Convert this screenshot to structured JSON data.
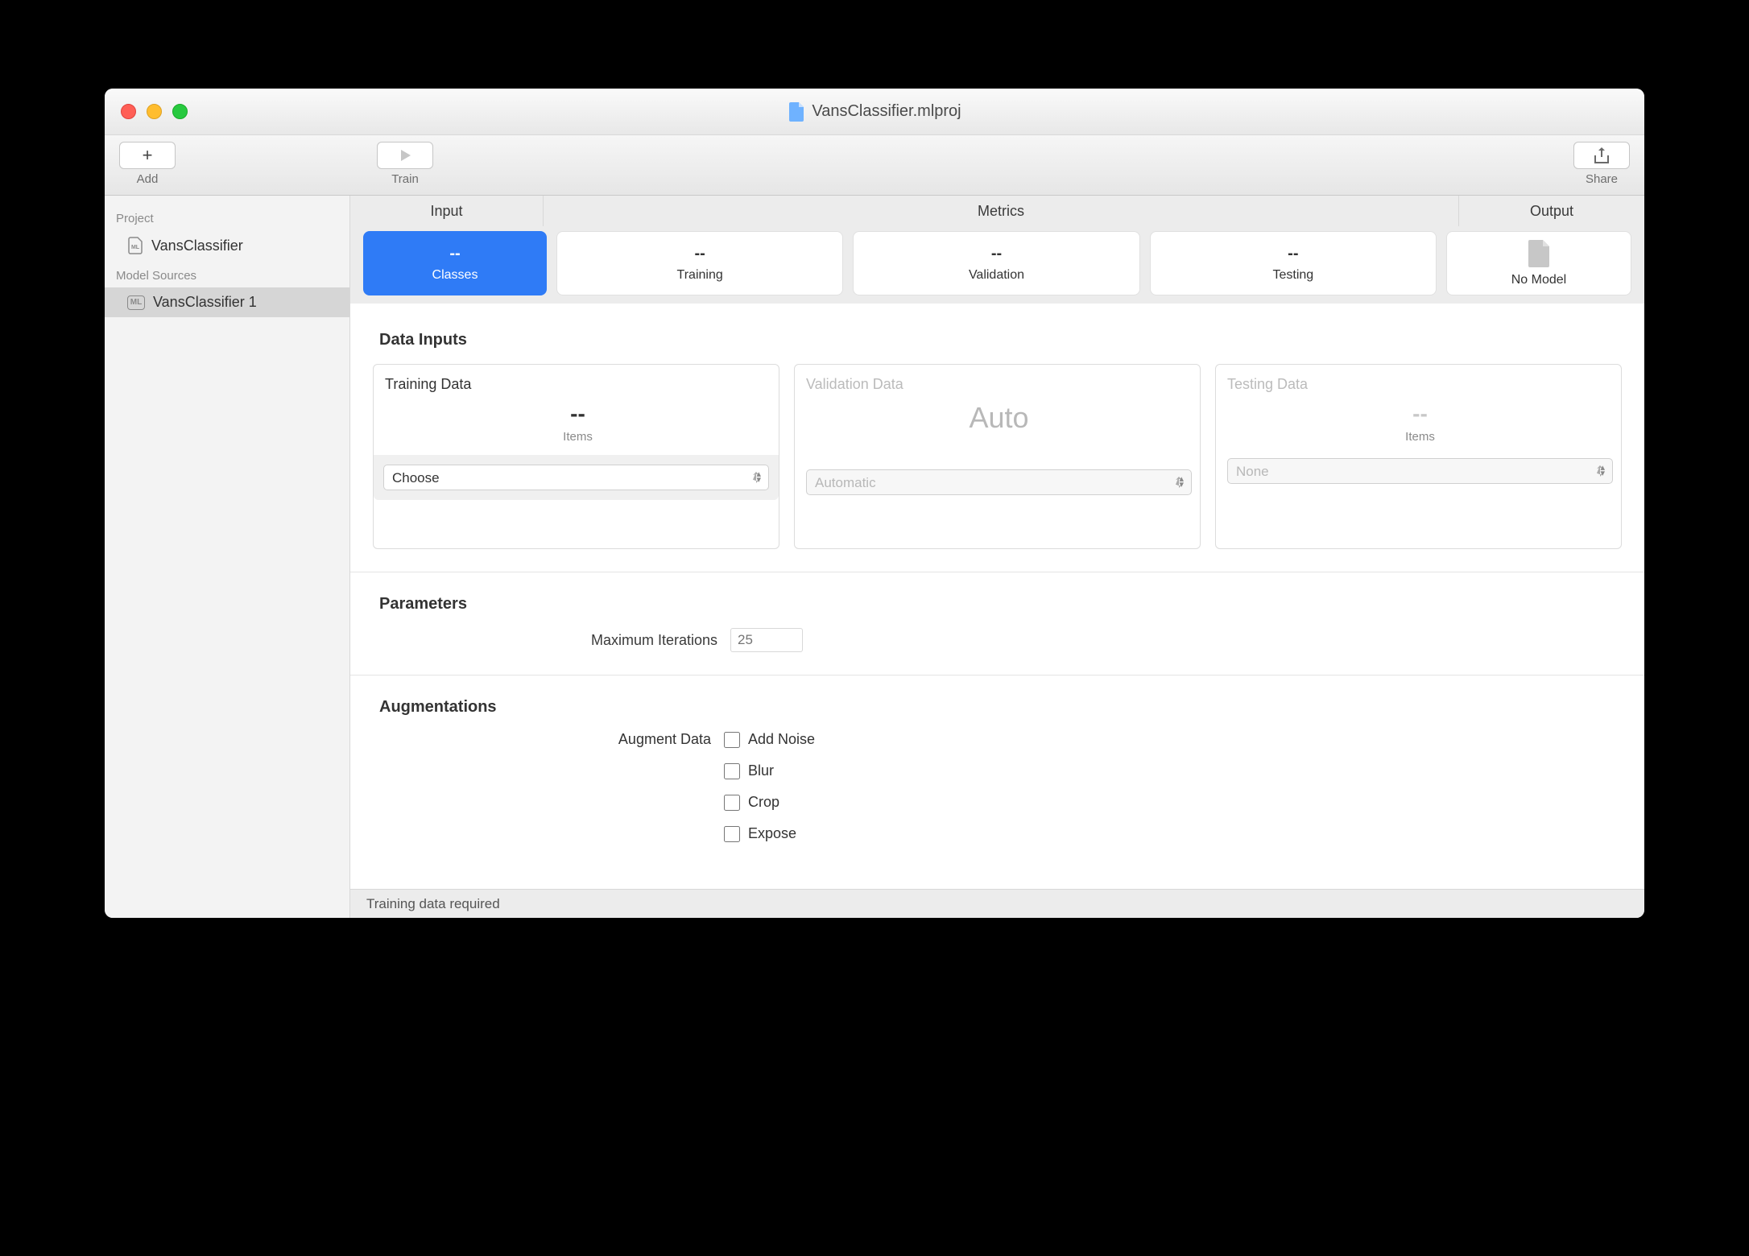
{
  "window": {
    "title": "VansClassifier.mlproj"
  },
  "toolbar": {
    "add_label": "Add",
    "train_label": "Train",
    "share_label": "Share"
  },
  "sidebar": {
    "project_header": "Project",
    "project_item": "VansClassifier",
    "sources_header": "Model Sources",
    "source_item": "VansClassifier 1"
  },
  "tabs": {
    "input": "Input",
    "metrics": "Metrics",
    "output": "Output"
  },
  "cards": {
    "classes": {
      "value": "--",
      "label": "Classes"
    },
    "training": {
      "value": "--",
      "label": "Training"
    },
    "validation": {
      "value": "--",
      "label": "Validation"
    },
    "testing": {
      "value": "--",
      "label": "Testing"
    },
    "output": {
      "label": "No Model"
    }
  },
  "sections": {
    "data_inputs": "Data Inputs",
    "parameters": "Parameters",
    "augmentations": "Augmentations"
  },
  "data_inputs": {
    "training": {
      "title": "Training Data",
      "value": "--",
      "sub": "Items",
      "select": "Choose"
    },
    "validation": {
      "title": "Validation Data",
      "value": "Auto",
      "select": "Automatic"
    },
    "testing": {
      "title": "Testing Data",
      "value": "--",
      "sub": "Items",
      "select": "None"
    }
  },
  "parameters": {
    "max_iter_label": "Maximum Iterations",
    "max_iter_value": "25"
  },
  "augmentations": {
    "label": "Augment Data",
    "options": [
      "Add Noise",
      "Blur",
      "Crop",
      "Expose"
    ]
  },
  "status": "Training data required"
}
